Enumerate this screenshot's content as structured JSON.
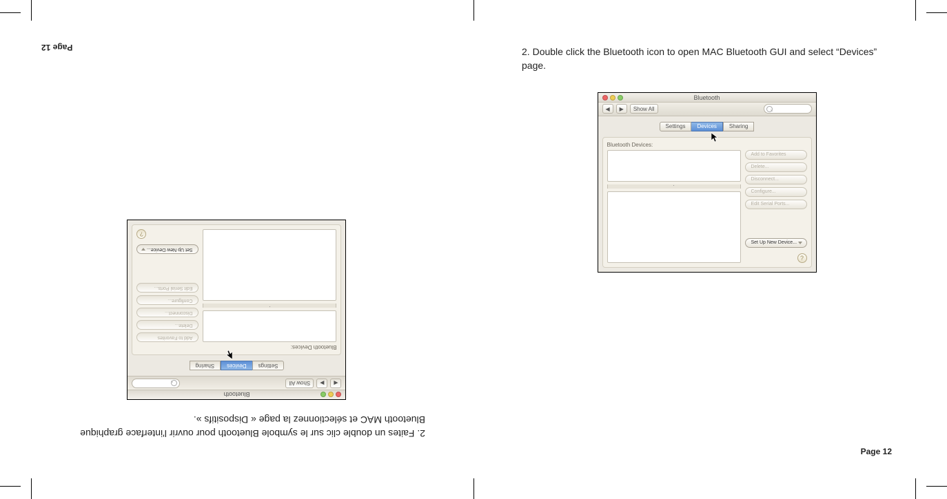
{
  "right": {
    "instruction_num": "2.",
    "instruction_text": "Double click the Bluetooth icon to open MAC Bluetooth GUI and select “Devices” page.",
    "page_label": "Page 12"
  },
  "left": {
    "instruction_num": "2.",
    "instruction_text": "Faites un double clic sur le symbole Bluetooth pour ouvrir l'interface graphique Bluetooth MAC et sélectionnez la page « Dispositifs ».",
    "page_label": "Page 12"
  },
  "mac": {
    "title": "Bluetooth",
    "show_all": "Show All",
    "tab_settings": "Settings",
    "tab_devices": "Devices",
    "tab_sharing": "Sharing",
    "devices_label": "Bluetooth Devices:",
    "btn_add_fav": "Add to Favorites",
    "btn_delete": "Delete...",
    "btn_disconnect": "Disconnect...",
    "btn_configure": "Configure...",
    "btn_edit_serial": "Edit Serial Ports...",
    "btn_setup_new": "Set Up New Device...",
    "help": "?"
  }
}
